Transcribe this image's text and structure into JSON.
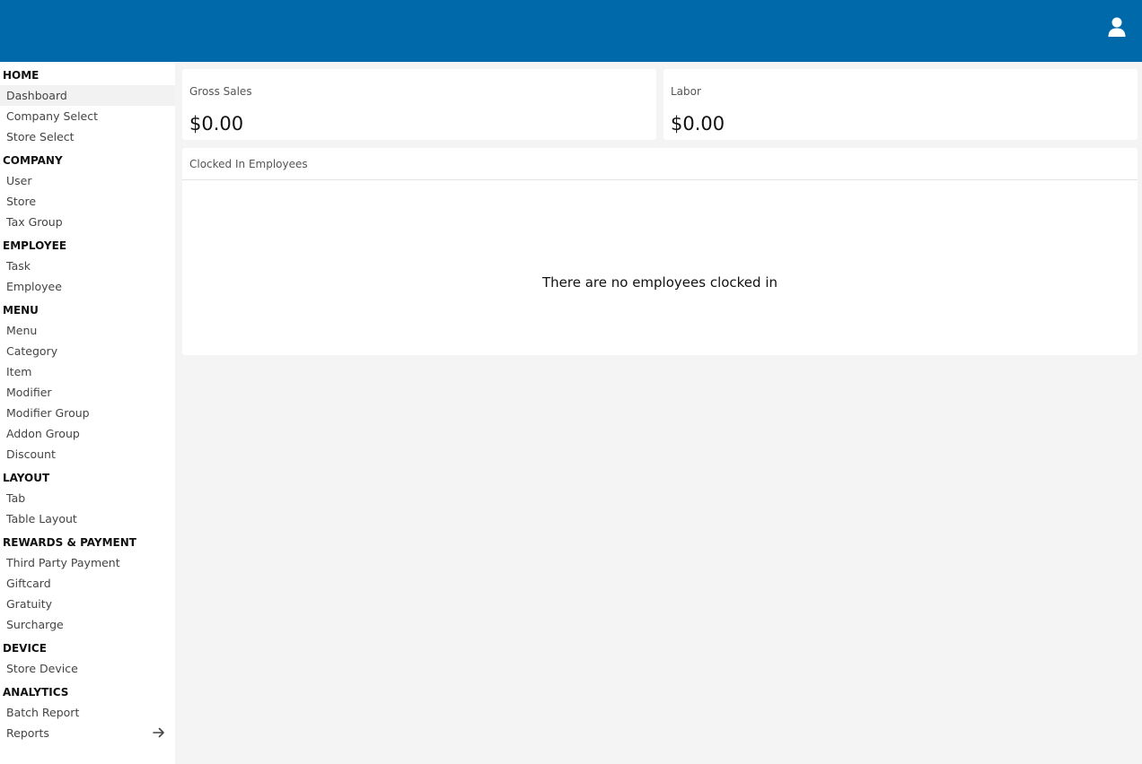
{
  "header": {
    "user_icon": "user-icon",
    "background_color": "#0069aa"
  },
  "sidebar": {
    "sections": [
      {
        "title": "HOME",
        "items": [
          {
            "label": "Dashboard",
            "active": true
          },
          {
            "label": "Company Select"
          },
          {
            "label": "Store Select"
          }
        ]
      },
      {
        "title": "COMPANY",
        "items": [
          {
            "label": "User"
          },
          {
            "label": "Store"
          },
          {
            "label": "Tax Group"
          }
        ]
      },
      {
        "title": "EMPLOYEE",
        "items": [
          {
            "label": "Task"
          },
          {
            "label": "Employee"
          }
        ]
      },
      {
        "title": "MENU",
        "items": [
          {
            "label": "Menu"
          },
          {
            "label": "Category"
          },
          {
            "label": "Item"
          },
          {
            "label": "Modifier"
          },
          {
            "label": "Modifier Group"
          },
          {
            "label": "Addon Group"
          },
          {
            "label": "Discount"
          }
        ]
      },
      {
        "title": "LAYOUT",
        "items": [
          {
            "label": "Tab"
          },
          {
            "label": "Table Layout"
          }
        ]
      },
      {
        "title": "REWARDS & PAYMENT",
        "items": [
          {
            "label": "Third Party Payment"
          },
          {
            "label": "Giftcard"
          },
          {
            "label": "Gratuity"
          },
          {
            "label": "Surcharge"
          }
        ]
      },
      {
        "title": "DEVICE",
        "items": [
          {
            "label": "Store Device"
          }
        ]
      },
      {
        "title": "ANALYTICS",
        "items": [
          {
            "label": "Batch Report"
          },
          {
            "label": "Reports",
            "icon": "arrow-right-icon"
          }
        ]
      }
    ]
  },
  "cards": {
    "gross_sales": {
      "label": "Gross Sales",
      "value": "$0.00"
    },
    "labor": {
      "label": "Labor",
      "value": "$0.00"
    },
    "clocked_in": {
      "title": "Clocked In Employees",
      "empty_message": "There are no employees clocked in"
    }
  }
}
